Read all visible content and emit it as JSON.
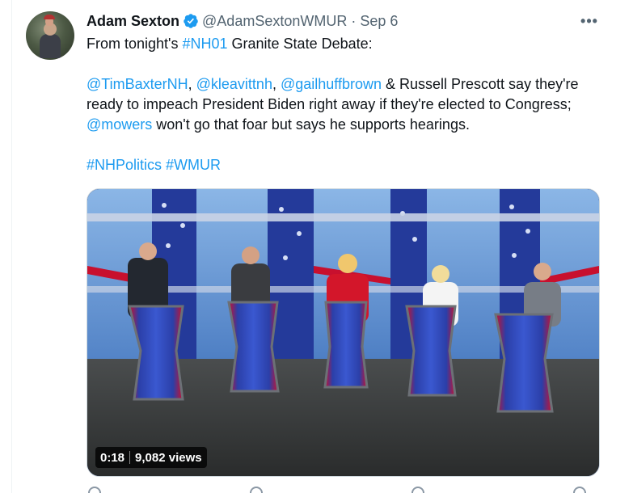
{
  "tweet": {
    "author_name": "Adam Sexton",
    "author_handle": "@AdamSextonWMUR",
    "separator": "·",
    "date": "Sep 6",
    "more_label": "•••",
    "line1_pre": "From tonight's ",
    "line1_tag": "#NH01",
    "line1_post": " Granite State Debate:",
    "p2_mention1": "@TimBaxterNH",
    "p2_sep1": ", ",
    "p2_mention2": "@kleavittnh",
    "p2_sep2": ", ",
    "p2_mention3": "@gailhuffbrown",
    "p2_text1": " & Russell Prescott say they're ready to impeach President Biden right away if they're elected to Congress; ",
    "p2_mention4": "@mowers",
    "p2_text2": " won't go that foar but says he supports hearings.",
    "tag1": "#NHPolitics",
    "tag_sep": " ",
    "tag2": "#WMUR"
  },
  "video": {
    "duration": "0:18",
    "views": "9,082 views"
  },
  "colors": {
    "link": "#1d9bf0",
    "text": "#0f1419",
    "muted": "#536471",
    "verified": "#1d9bf0"
  },
  "icons": [
    "verified-badge-icon",
    "more-options-icon",
    "reply-icon",
    "retweet-icon",
    "like-icon",
    "share-icon"
  ]
}
